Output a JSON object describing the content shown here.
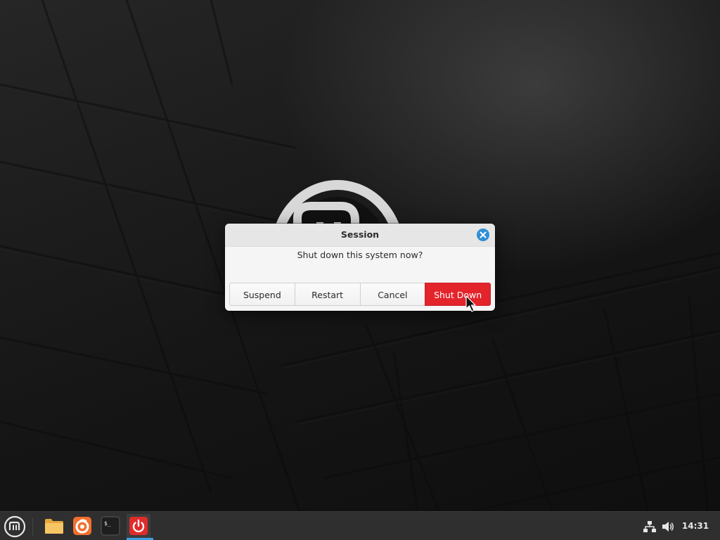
{
  "wallpaper": {
    "colors": {
      "base": "#1b1b1b",
      "highlight": "#6e6e6e",
      "tile_edge": "#0a0a0a"
    },
    "logo_icon": "linux-mint-logo"
  },
  "dialog": {
    "title": "Session",
    "message": "Shut down this system now?",
    "close_icon": "close-icon",
    "buttons": [
      {
        "label": "Suspend",
        "style": "normal"
      },
      {
        "label": "Restart",
        "style": "normal"
      },
      {
        "label": "Cancel",
        "style": "normal"
      },
      {
        "label": "Shut Down",
        "style": "destructive"
      }
    ],
    "colors": {
      "destructive": "#e3242b",
      "close_button": "#2e8fd4",
      "titlebar": "#e6e6e6",
      "body": "#f5f5f5"
    }
  },
  "cursor": {
    "icon": "mouse-pointer-icon"
  },
  "taskbar": {
    "menu_icon": "linux-mint-menu-icon",
    "launchers": [
      {
        "name": "files",
        "icon": "folder-icon"
      },
      {
        "name": "firefox",
        "icon": "firefox-icon"
      },
      {
        "name": "terminal",
        "icon": "terminal-icon",
        "glyph": "$_"
      },
      {
        "name": "session",
        "icon": "power-icon",
        "active": true
      }
    ],
    "tray": [
      {
        "icon": "network-icon"
      },
      {
        "icon": "volume-icon"
      }
    ],
    "clock": "14:31",
    "colors": {
      "background": "#2f2f2f",
      "active_indicator": "#3aa0e0",
      "power_button": "#e02b2b"
    }
  }
}
